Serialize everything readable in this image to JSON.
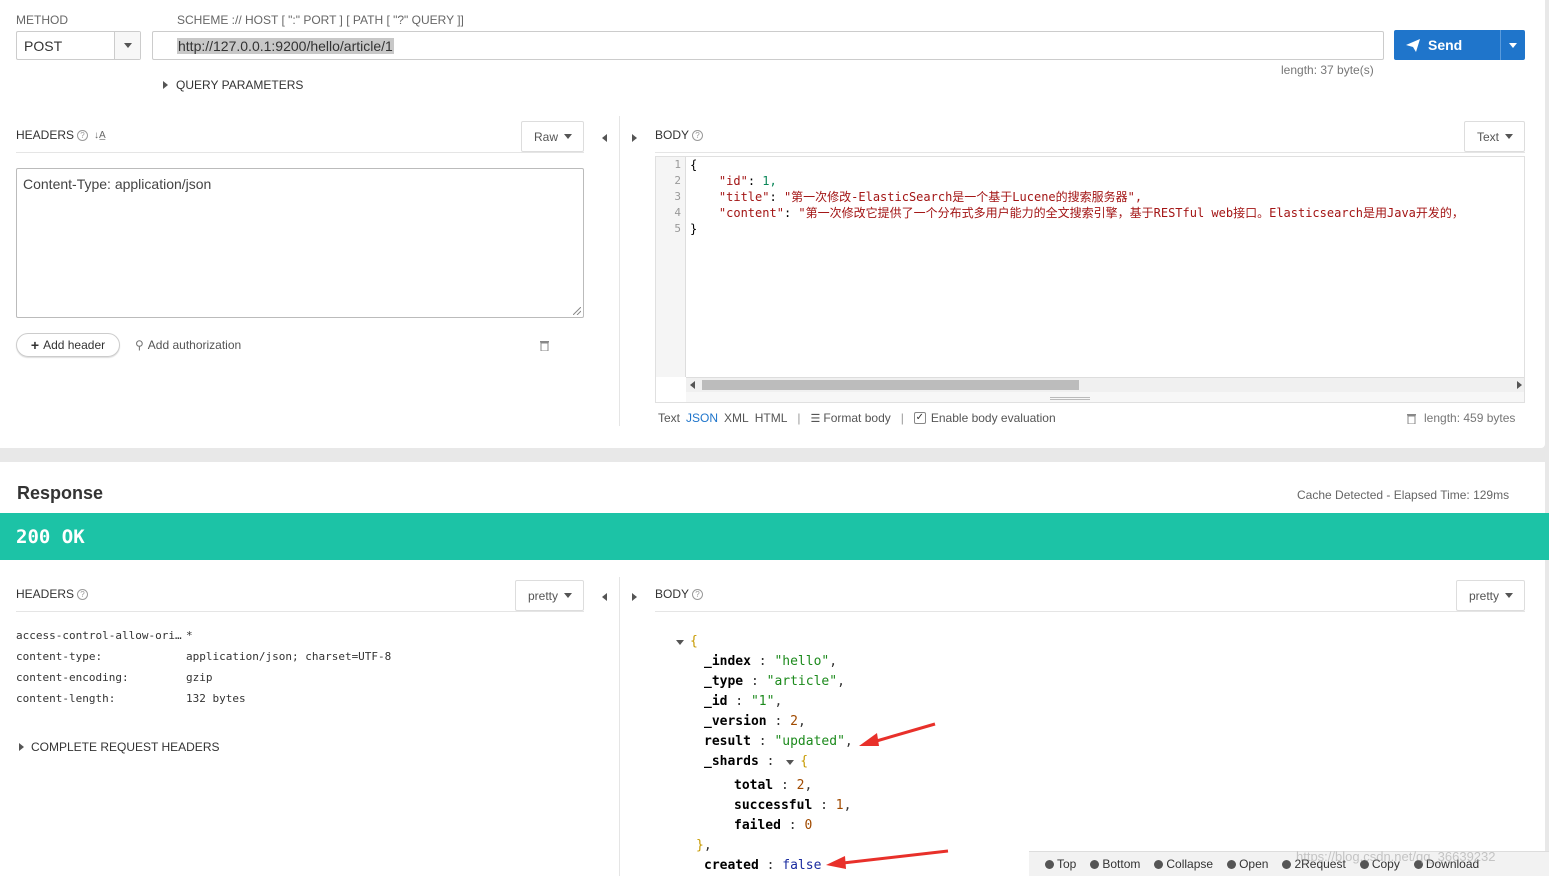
{
  "request": {
    "method_label": "METHOD",
    "method_value": "POST",
    "url_label": "SCHEME :// HOST [ \":\" PORT ] [ PATH [ \"?\" QUERY ]]",
    "url_value": "http://127.0.0.1:9200/hello/article/1",
    "url_length": "length: 37 byte(s)",
    "send_label": "Send",
    "query_params_label": "QUERY PARAMETERS",
    "headers_label": "HEADERS",
    "headers_mode": "Raw",
    "headers_text": "Content-Type: application/json",
    "add_header_label": "Add header",
    "add_auth_label": "Add authorization",
    "body_label": "BODY",
    "body_mode": "Text",
    "body_lines": [
      "{",
      "    \"id\": 1,",
      "    \"title\": \"第一次修改-ElasticSearch是一个基于Lucene的搜索服务器\",",
      "    \"content\": \"第一次修改它提供了一个分布式多用户能力的全文搜索引擎，基于RESTful web接口。Elasticsearch是用Java开发的，",
      "}"
    ],
    "line_numbers": [
      "1",
      "2",
      "3",
      "4",
      "5"
    ],
    "formats": [
      "Text",
      "JSON",
      "XML",
      "HTML"
    ],
    "active_format": "JSON",
    "format_body_label": "Format body",
    "enable_eval_label": "Enable body evaluation",
    "body_length": "length: 459 bytes"
  },
  "response": {
    "title": "Response",
    "elapsed": "Cache Detected - Elapsed Time: 129ms",
    "status": "200 OK",
    "headers_label": "HEADERS",
    "headers_mode": "pretty",
    "body_label": "BODY",
    "body_mode": "pretty",
    "headers": [
      {
        "name": "access-control-allow-ori…",
        "value": "*"
      },
      {
        "name": "content-type:",
        "value": "application/json; charset=UTF-8"
      },
      {
        "name": "content-encoding:",
        "value": "gzip"
      },
      {
        "name": "content-length:",
        "value": "132 bytes"
      }
    ],
    "complete_headers_label": "COMPLETE REQUEST HEADERS",
    "json": {
      "index_key": "_index",
      "index_val": "\"hello\"",
      "type_key": "_type",
      "type_val": "\"article\"",
      "id_key": "_id",
      "id_val": "\"1\"",
      "version_key": "_version",
      "version_val": "2",
      "result_key": "result",
      "result_val": "\"updated\"",
      "shards_key": "_shards",
      "total_key": "total",
      "total_val": "2",
      "successful_key": "successful",
      "successful_val": "1",
      "failed_key": "failed",
      "failed_val": "0",
      "created_key": "created",
      "created_val": "false"
    },
    "toolbar": [
      "Top",
      "Bottom",
      "Collapse",
      "Open",
      "2Request",
      "Copy",
      "Download"
    ]
  },
  "watermark": "https://blog.csdn.net/qq_36639232",
  "colors": {
    "accent": "#1f75cb",
    "status_bar": "#1cc3a6",
    "annotation": "#e8302a"
  }
}
